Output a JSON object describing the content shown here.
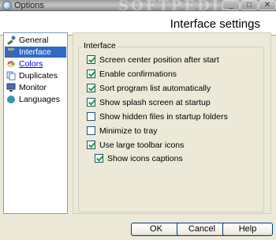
{
  "window": {
    "title": "Options",
    "watermark": "SOFTPEDIA"
  },
  "header": {
    "title": "Interface settings"
  },
  "nav": [
    {
      "label": "General",
      "icon": "wrench-icon"
    },
    {
      "label": "Interface",
      "icon": "hammer-icon",
      "selected": true
    },
    {
      "label": "Colors",
      "icon": "palette-icon"
    },
    {
      "label": "Duplicates",
      "icon": "duplicate-icon"
    },
    {
      "label": "Monitor",
      "icon": "monitor-icon"
    },
    {
      "label": "Languages",
      "icon": "globe-icon"
    }
  ],
  "group": {
    "label": "Interface",
    "options": [
      {
        "label": "Screen center position after start",
        "checked": true
      },
      {
        "label": "Enable confirmations",
        "checked": true
      },
      {
        "label": "Sort program list automatically",
        "checked": true
      },
      {
        "label": "Show splash screen at startup",
        "checked": true
      },
      {
        "label": "Show hidden files in startup folders",
        "checked": false
      },
      {
        "label": "Minimize to tray",
        "checked": false
      },
      {
        "label": "Use large toolbar icons",
        "checked": true
      },
      {
        "label": "Show icons captions",
        "checked": true
      }
    ]
  },
  "buttons": {
    "ok": "OK",
    "cancel": "Cancel",
    "help": "Help"
  },
  "colors": {
    "selection": "#316ac5",
    "check": "#21a121",
    "link": "#0000ee"
  }
}
